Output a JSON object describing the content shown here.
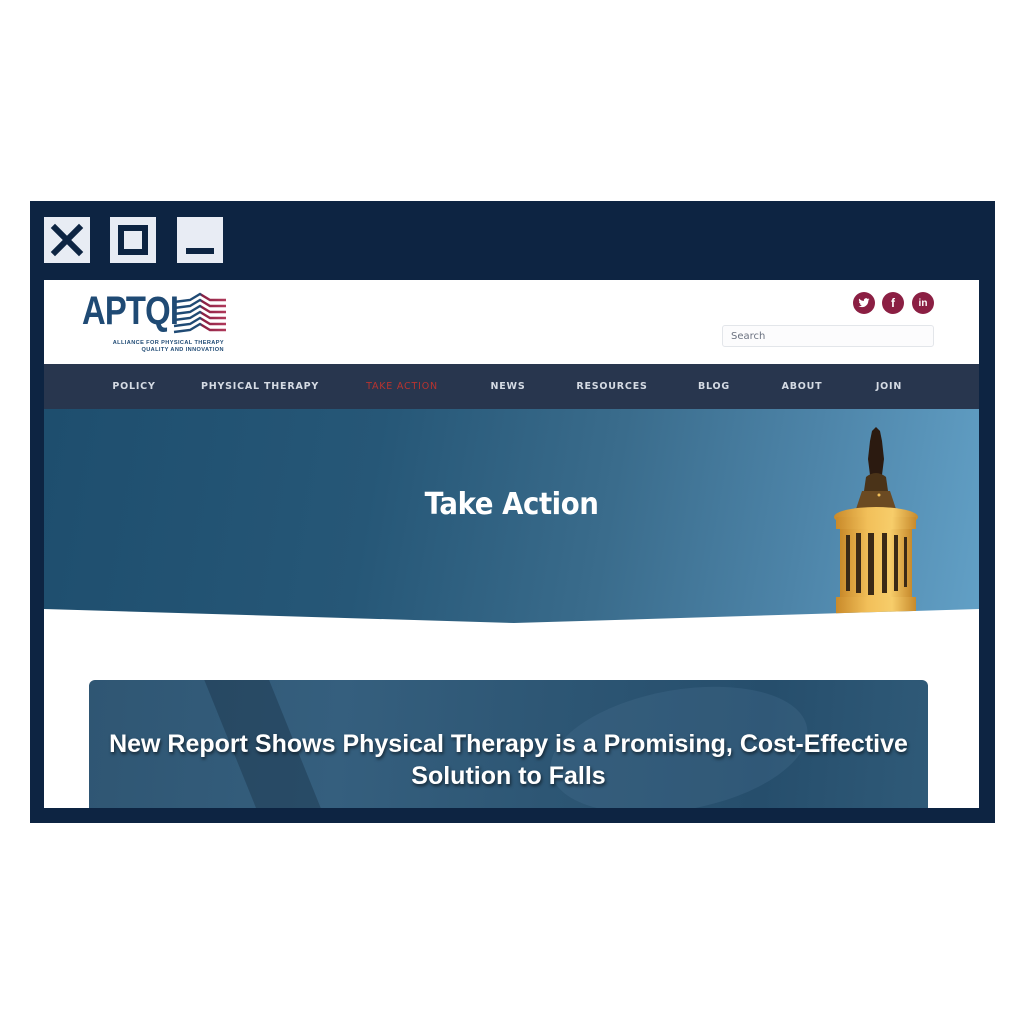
{
  "window": {
    "controls": [
      {
        "name": "close",
        "icon": "close-icon"
      },
      {
        "name": "maximize",
        "icon": "maximize-icon"
      },
      {
        "name": "minimize",
        "icon": "minimize-icon"
      }
    ]
  },
  "header": {
    "logo_text": "APTQI",
    "logo_tagline_line1": "ALLIANCE FOR PHYSICAL THERAPY",
    "logo_tagline_line2": "QUALITY AND INNOVATION",
    "brand_colors": {
      "navy": "#1f4a74",
      "red": "#8b1f43"
    },
    "social": [
      {
        "name": "twitter",
        "glyph": "t"
      },
      {
        "name": "facebook",
        "glyph": "f"
      },
      {
        "name": "linkedin",
        "glyph": "in"
      }
    ],
    "search_placeholder": "Search"
  },
  "nav": {
    "active_color": "#b8332f",
    "items": [
      {
        "label": "POLICY",
        "active": false
      },
      {
        "label": "PHYSICAL THERAPY",
        "active": false
      },
      {
        "label": "TAKE ACTION",
        "active": true
      },
      {
        "label": "NEWS",
        "active": false
      },
      {
        "label": "RESOURCES",
        "active": false
      },
      {
        "label": "BLOG",
        "active": false
      },
      {
        "label": "ABOUT",
        "active": false
      },
      {
        "label": "JOIN",
        "active": false
      }
    ]
  },
  "hero": {
    "title": "Take Action"
  },
  "featured": {
    "title": "New Report Shows Physical Therapy is a Promising, Cost-Effective Solution to Falls"
  }
}
